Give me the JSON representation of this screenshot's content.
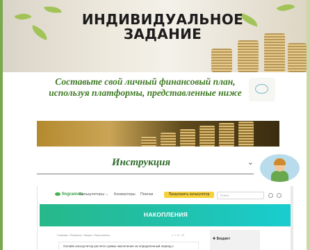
{
  "banner": {
    "title": "ИНДИВИДУАЛЬНОЕ ЗАДАНИЕ"
  },
  "task": {
    "text": "Составьте свой личный финансовый план, используя платформы, представленные ниже"
  },
  "instruction": {
    "label": "Инструкция",
    "chevron": "⌄"
  },
  "site": {
    "logo": "fingramota",
    "nav": [
      "Калькуляторы ⌵",
      "Конвертеры",
      "Поиски"
    ],
    "cta": "Предложить калькулятор",
    "search_placeholder": "Поиск",
    "hero_title": "НАКОПЛЕНИЯ",
    "breadcrumb": "Главная  /  Финансы  /  Акции  /  Накопления",
    "meta": "1  ☆ 5  ⌁  ⟳",
    "panel_header": "✚ Бюджет",
    "card_text": "Онлайн калькулятор расчета суммы накопления за определенный период с"
  },
  "colors": {
    "page_border": "#8fb86a",
    "subtitle_green": "#3f7a25",
    "hero_start": "#27b88a",
    "hero_end": "#19cdd0",
    "cta_yellow": "#f5d13b"
  }
}
